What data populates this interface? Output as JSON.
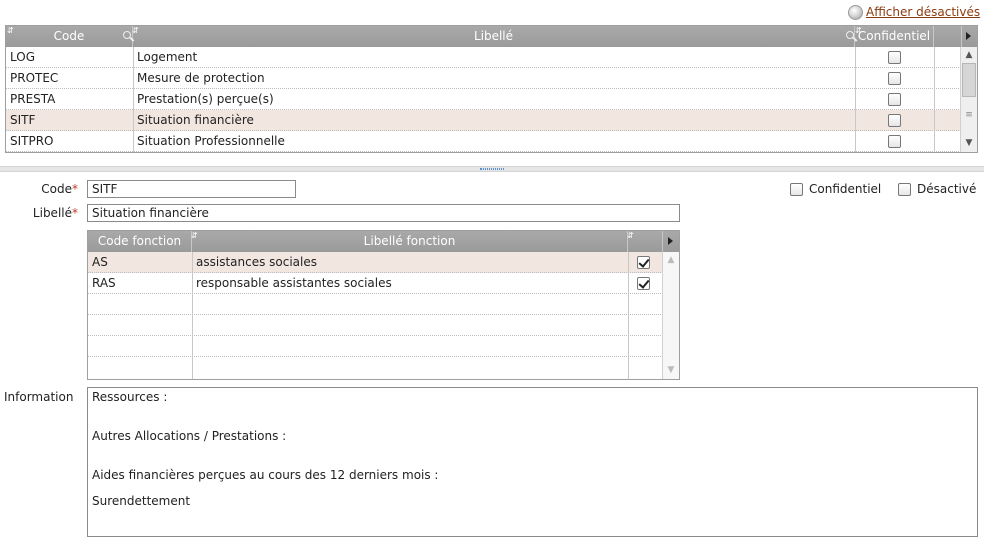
{
  "header": {
    "show_disabled_label": "Afficher désactivés"
  },
  "top_grid": {
    "columns": {
      "code": "Code",
      "libelle": "Libellé",
      "confidentiel": "Confidentiel"
    },
    "rows": [
      {
        "code": "LOG",
        "libelle": "Logement",
        "confidentiel": false
      },
      {
        "code": "PROTEC",
        "libelle": "Mesure de protection",
        "confidentiel": false
      },
      {
        "code": "PRESTA",
        "libelle": "Prestation(s) perçue(s)",
        "confidentiel": false
      },
      {
        "code": "SITF",
        "libelle": "Situation financière",
        "confidentiel": false,
        "selected": true
      },
      {
        "code": "SITPRO",
        "libelle": "Situation Professionnelle",
        "confidentiel": false
      }
    ]
  },
  "form": {
    "code_label": "Code",
    "code_value": "SITF",
    "libelle_label": "Libellé",
    "libelle_value": "Situation financière",
    "required_mark": "*",
    "confidentiel_label": "Confidentiel",
    "desactive_label": "Désactivé",
    "information_label": "Information"
  },
  "function_grid": {
    "columns": {
      "code": "Code fonction",
      "libelle": "Libellé fonction"
    },
    "rows": [
      {
        "code": "AS",
        "libelle": "assistances sociales",
        "checked": true,
        "selected": true
      },
      {
        "code": "RAS",
        "libelle": "responsable assistantes sociales",
        "checked": true
      }
    ]
  },
  "information": {
    "lines": [
      "Ressources :",
      "Autres Allocations / Prestations :",
      "Aides financières perçues au cours des 12 derniers mois :",
      "Surendettement"
    ]
  }
}
